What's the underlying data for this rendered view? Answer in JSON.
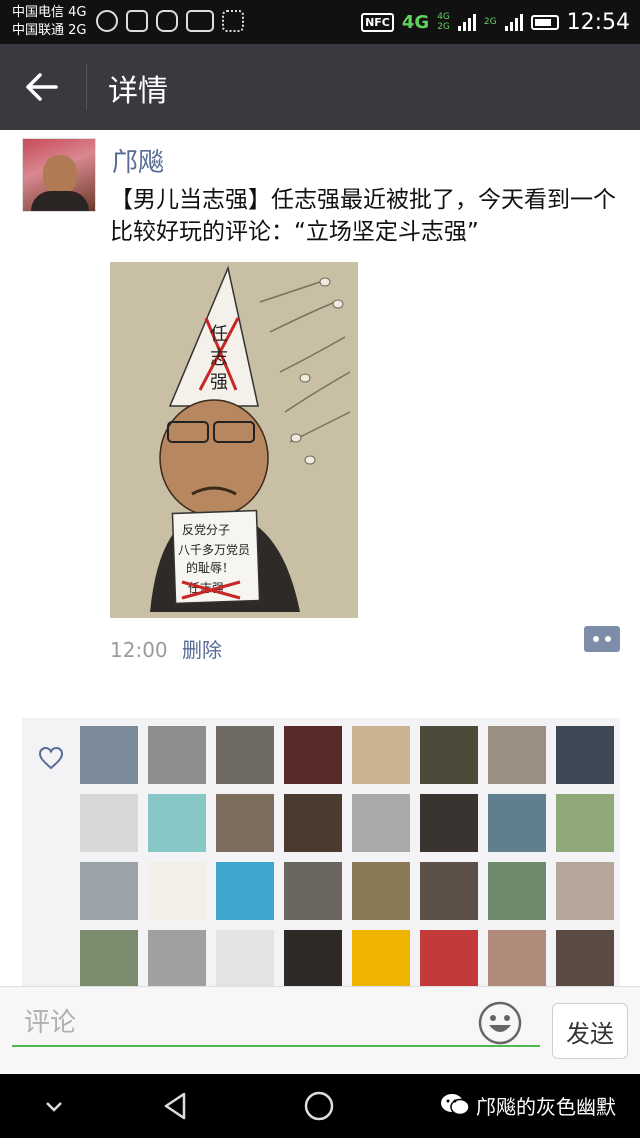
{
  "status_bar": {
    "carrier_1": "中国电信 4G",
    "carrier_2": "中国联通 2G",
    "nfc": "NFC",
    "network": "4G",
    "network_mini_1": "4G",
    "network_mini_2": "2G",
    "network_mini_3": "2G",
    "time": "12:54"
  },
  "header": {
    "title": "详情"
  },
  "post": {
    "author": "邝飚",
    "text": "【男儿当志强】任志强最近被批了，今天看到一个比较好玩的评论：“立场坚定斗志强”",
    "image_caption_hat_line1": "任",
    "image_caption_hat_line2": "志",
    "image_caption_hat_line3": "强",
    "image_sign_line1": "反党分子",
    "image_sign_line2": "八千多万党员",
    "image_sign_line3": "的耻辱！",
    "image_sign_line4": "任志强",
    "time": "12:00",
    "delete_label": "删除"
  },
  "likes": {
    "count_rows": 4,
    "avatars": [
      {
        "name": "like-avatar-1",
        "color": "#7a8a99"
      },
      {
        "name": "like-avatar-2",
        "color": "#8e8e8e"
      },
      {
        "name": "like-avatar-3",
        "color": "#6f6a63"
      },
      {
        "name": "like-avatar-4",
        "color": "#5a2a28"
      },
      {
        "name": "like-avatar-5",
        "color": "#c9b48f"
      },
      {
        "name": "like-avatar-6",
        "color": "#4e4a3a"
      },
      {
        "name": "like-avatar-7",
        "color": "#9a8f80"
      },
      {
        "name": "like-avatar-8",
        "color": "#3d4a55"
      },
      {
        "name": "like-avatar-9",
        "color": "#d8d8d8"
      },
      {
        "name": "like-avatar-10",
        "color": "#86c7c5"
      },
      {
        "name": "like-avatar-11",
        "color": "#7d6d5d"
      },
      {
        "name": "like-avatar-12",
        "color": "#4b3b2e"
      },
      {
        "name": "like-avatar-13",
        "color": "#a9a9a9"
      },
      {
        "name": "like-avatar-14",
        "color": "#3a3431"
      },
      {
        "name": "like-avatar-15",
        "color": "#5f7f8f"
      },
      {
        "name": "like-avatar-16",
        "color": "#8fa87a"
      },
      {
        "name": "like-avatar-17",
        "color": "#9aa3a8"
      },
      {
        "name": "like-avatar-18",
        "color": "#f2efe8"
      },
      {
        "name": "like-avatar-19",
        "color": "#3ea7d0"
      },
      {
        "name": "like-avatar-20",
        "color": "#6b6660"
      },
      {
        "name": "like-avatar-21",
        "color": "#8a7a55"
      },
      {
        "name": "like-avatar-22",
        "color": "#5c5048"
      },
      {
        "name": "like-avatar-23",
        "color": "#6f8a6a"
      },
      {
        "name": "like-avatar-24",
        "color": "#b7a79a"
      },
      {
        "name": "like-avatar-25",
        "color": "#7b8b6d"
      },
      {
        "name": "like-avatar-26",
        "color": "#a0a0a0"
      },
      {
        "name": "like-avatar-27",
        "color": "#e3e3e3"
      },
      {
        "name": "like-avatar-28",
        "color": "#2f2a26"
      },
      {
        "name": "like-avatar-29",
        "color": "#f0b400"
      },
      {
        "name": "like-avatar-30",
        "color": "#c43a3a"
      },
      {
        "name": "like-avatar-31",
        "color": "#b08a7a"
      },
      {
        "name": "like-avatar-32",
        "color": "#5a4a42"
      }
    ]
  },
  "comment_bar": {
    "placeholder": "评论",
    "send_label": "发送"
  },
  "watermark": {
    "text": "邝飚的灰色幽默"
  },
  "colors": {
    "link": "#576b95",
    "title_bar": "#393a3f",
    "input_underline": "#4fb84a"
  }
}
